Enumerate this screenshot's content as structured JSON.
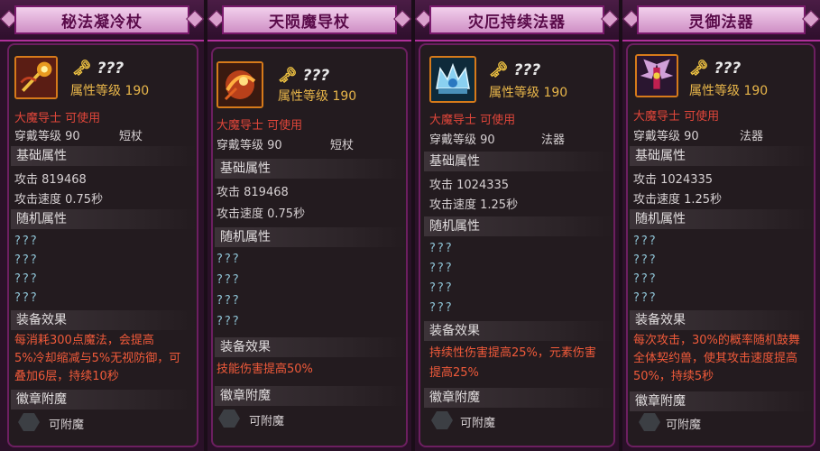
{
  "cards": [
    {
      "title": "秘法凝冷杖",
      "name": "???",
      "attr_level": "属性等级 190",
      "usable": "大魔导士 可使用",
      "wear_level": "穿戴等级 90",
      "weapon_type": "短杖",
      "base_header": "基础属性",
      "attack": "攻击 819468",
      "speed": "攻击速度 0.75秒",
      "random_header": "随机属性",
      "random": [
        "???",
        "???",
        "???",
        "???"
      ],
      "effect_header": "装备效果",
      "effect": [
        "每消耗300点魔法，会提高",
        "5%冷却缩减与5%无视防御，可",
        "叠加6层，持续10秒"
      ],
      "medal_header": "徽章附魔",
      "medal_text": "可附魔"
    },
    {
      "title": "天陨魔导杖",
      "name": "???",
      "attr_level": "属性等级 190",
      "usable": "大魔导士 可使用",
      "wear_level": "穿戴等级 90",
      "weapon_type": "短杖",
      "base_header": "基础属性",
      "attack": "攻击 819468",
      "speed": "攻击速度 0.75秒",
      "random_header": "随机属性",
      "random": [
        "???",
        "???",
        "???",
        "???"
      ],
      "effect_header": "装备效果",
      "effect": [
        "技能伤害提高50%"
      ],
      "medal_header": "徽章附魔",
      "medal_text": "可附魔"
    },
    {
      "title": "灾厄持续法器",
      "name": "???",
      "attr_level": "属性等级 190",
      "usable": "大魔导士 可使用",
      "wear_level": "穿戴等级 90",
      "weapon_type": "法器",
      "base_header": "基础属性",
      "attack": "攻击 1024335",
      "speed": "攻击速度 1.25秒",
      "random_header": "随机属性",
      "random": [
        "???",
        "???",
        "???",
        "???"
      ],
      "effect_header": "装备效果",
      "effect": [
        "持续性伤害提高25%，元素伤害",
        "提高25%"
      ],
      "medal_header": "徽章附魔",
      "medal_text": "可附魔"
    },
    {
      "title": "灵御法器",
      "name": "???",
      "attr_level": "属性等级 190",
      "usable": "大魔导士 可使用",
      "wear_level": "穿戴等级 90",
      "weapon_type": "法器",
      "base_header": "基础属性",
      "attack": "攻击 1024335",
      "speed": "攻击速度 1.25秒",
      "random_header": "随机属性",
      "random": [
        "???",
        "???",
        "???",
        "???"
      ],
      "effect_header": "装备效果",
      "effect": [
        "每次攻击，30%的概率随机鼓舞",
        "全体契约兽，使其攻击速度提高",
        "50%，持续5秒"
      ],
      "medal_header": "徽章附魔",
      "medal_text": "可附魔"
    }
  ],
  "colors": {
    "title_text": "#5a0b4a",
    "level_gold": "#e8b64a",
    "red_text": "#e0463a",
    "effect_text": "#f05a3a",
    "random_text": "#8fc4d6",
    "frame_purple": "#6c1f60"
  },
  "icons": [
    "key-icon",
    "staff-item-icon",
    "orb-item-icon",
    "crown-item-icon",
    "wings-item-icon",
    "medal-slot-icon"
  ]
}
